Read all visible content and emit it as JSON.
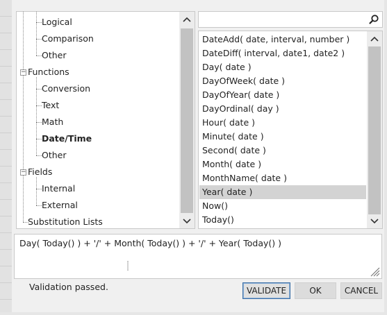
{
  "tree": {
    "items": [
      {
        "label": "Logical"
      },
      {
        "label": "Comparison"
      },
      {
        "label": "Other"
      },
      {
        "label": "Functions",
        "expander": "−"
      },
      {
        "label": "Conversion"
      },
      {
        "label": "Text"
      },
      {
        "label": "Math"
      },
      {
        "label": "Date/Time",
        "selected": true
      },
      {
        "label": "Other"
      },
      {
        "label": "Fields",
        "expander": "−"
      },
      {
        "label": "Internal"
      },
      {
        "label": "External"
      },
      {
        "label": "Substitution Lists"
      }
    ]
  },
  "search": {
    "value": "",
    "placeholder": "",
    "icon": "search-icon"
  },
  "functions": {
    "items": [
      "DateAdd( date, interval, number )",
      "DateDiff( interval, date1, date2 )",
      "Day( date )",
      "DayOfWeek( date )",
      "DayOfYear( date )",
      "DayOrdinal( day )",
      "Hour( date )",
      "Minute( date )",
      "Second( date )",
      "Month( date )",
      "MonthName( date )",
      "Year( date )",
      "Now()",
      "Today()"
    ],
    "selected": "Year( date )"
  },
  "expression": {
    "text": "Day( Today() ) + '/' + Month( Today() ) + '/' + Year( Today() )"
  },
  "status": {
    "validation": "Validation passed."
  },
  "buttons": {
    "validate": "VALIDATE",
    "ok": "OK",
    "cancel": "CANCEL"
  },
  "colors": {
    "selected_row": "#d3d3d3",
    "panel_border": "#c8c8c8",
    "scroll_thumb": "#c2c2c2",
    "dialog_bg": "#f0f0f0"
  }
}
